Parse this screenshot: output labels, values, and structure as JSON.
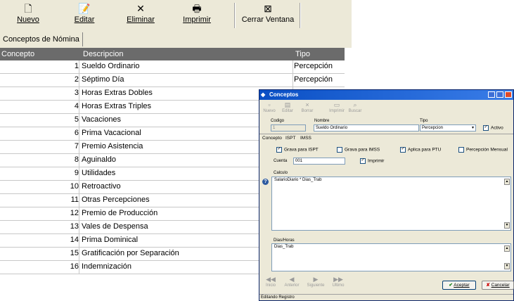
{
  "toolbar": {
    "buttons": [
      {
        "label": "Nuevo",
        "icon": "new-document-icon",
        "glyph": "🗋"
      },
      {
        "label": "Editar",
        "icon": "edit-icon",
        "glyph": "📝"
      },
      {
        "label": "Eliminar",
        "icon": "delete-icon",
        "glyph": "✕"
      },
      {
        "label": "Imprimir",
        "icon": "printer-icon",
        "glyph": "🖶"
      },
      {
        "label": "Cerrar Ventana",
        "icon": "close-window-icon",
        "glyph": "⊠"
      }
    ]
  },
  "tab": {
    "label": "Conceptos de Nómina"
  },
  "grid": {
    "headers": [
      "Concepto",
      "Descripcion",
      "Tipo"
    ],
    "rows": [
      {
        "num": "1",
        "desc": "Sueldo Ordinario",
        "tipo": "Percepción"
      },
      {
        "num": "2",
        "desc": "Séptimo Día",
        "tipo": "Percepción"
      },
      {
        "num": "3",
        "desc": "Horas Extras Dobles",
        "tipo": ""
      },
      {
        "num": "4",
        "desc": "Horas Extras Triples",
        "tipo": ""
      },
      {
        "num": "5",
        "desc": "Vacaciones",
        "tipo": ""
      },
      {
        "num": "6",
        "desc": "Prima Vacacional",
        "tipo": ""
      },
      {
        "num": "7",
        "desc": "Premio Asistencia",
        "tipo": ""
      },
      {
        "num": "8",
        "desc": "Aguinaldo",
        "tipo": ""
      },
      {
        "num": "9",
        "desc": "Utilidades",
        "tipo": ""
      },
      {
        "num": "10",
        "desc": "Retroactivo",
        "tipo": ""
      },
      {
        "num": "11",
        "desc": "Otras Percepciones",
        "tipo": ""
      },
      {
        "num": "12",
        "desc": "Premio de Producción",
        "tipo": ""
      },
      {
        "num": "13",
        "desc": "Vales de Despensa",
        "tipo": ""
      },
      {
        "num": "14",
        "desc": "Prima Dominical",
        "tipo": ""
      },
      {
        "num": "15",
        "desc": "Gratificación por Separación",
        "tipo": ""
      },
      {
        "num": "16",
        "desc": "Indemnización",
        "tipo": ""
      }
    ]
  },
  "dialog": {
    "title": "Conceptos",
    "toolbar": [
      "Nuevo",
      "Editar",
      "Borrar",
      "Imprimir",
      "Buscar"
    ],
    "codigo_label": "Codigo",
    "codigo_value": "1",
    "nombre_label": "Nombre",
    "nombre_value": "Sueldo Ordinario",
    "tipo_label": "Tipo",
    "tipo_value": "Percepcion",
    "activo_label": "Activo",
    "tabs": [
      "Concepto",
      "ISPT",
      "IMSS"
    ],
    "checks": {
      "grava_ispt": "Grava para ISPT",
      "grava_imss": "Grava para IMSS",
      "aplica_ptu": "Aplica para PTU",
      "percepcion_mensual": "Percepción Mensual",
      "imprimir": "Imprimir"
    },
    "cuenta_label": "Cuenta",
    "cuenta_value": "001",
    "calculo_label": "Calculo",
    "calculo_value": "SalarioDiario * Dias_Trab",
    "dias_label": "Dias/Horas",
    "dias_value": "Dias_Trab",
    "nav": [
      "Inicio",
      "Anterior",
      "Siguiente",
      "Ultimo"
    ],
    "aceptar": "Aceptar",
    "cancelar": "Cancelar",
    "status": "Editando Registro"
  },
  "colors": {
    "title_bar": "#0a4fc4",
    "grid_header": "#6b6b6b",
    "face": "#ece9d8"
  }
}
